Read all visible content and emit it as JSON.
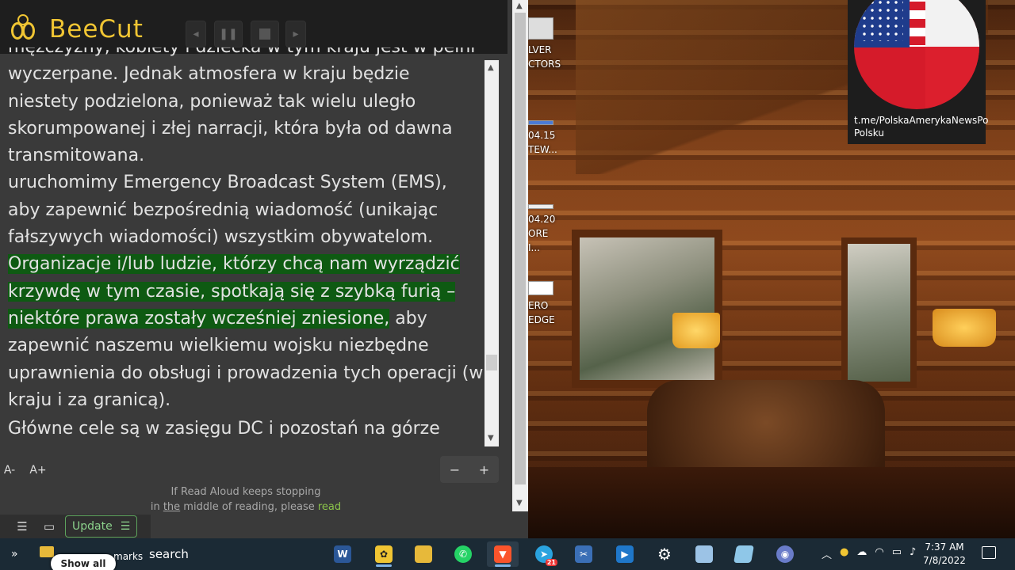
{
  "reader": {
    "brand": "BeeCut",
    "paragraphs": [
      "mężczyzny, kobiety i dziecka w tym kraju jest w pełni wyczerpane. Jednak atmosfera w kraju będzie niestety podzielona, ponieważ tak wielu uległo skorumpowanej i złej narracji, która była od dawna transmitowana.",
      "uruchomimy Emergency Broadcast System (EMS), aby zapewnić bezpośrednią wiadomość (unikając fałszywych wiadomości) wszystkim obywatelom."
    ],
    "highlighted": "Organizacje i/lub ludzie, którzy chcą nam wyrządzić krzywdę w tym czasie, spotkają się z szybką furią – niektóre prawa zostały wcześniej zniesione,",
    "after_highlight": " aby zapewnić naszemu wielkiemu wojsku niezbędne uprawnienia do obsługi i prowadzenia tych operacji (w kraju i za granicą).",
    "last_line": "Główne cele są w zasięgu DC i pozostań na górze",
    "font_decrease": "A-",
    "font_increase": "A+",
    "zoom_minus": "−",
    "zoom_plus": "+",
    "notice_1": "If Read Aloud keeps stopping",
    "notice_2a": "in ",
    "notice_2b": "the",
    "notice_2c": " middle of reading, please ",
    "notice_2d": "read",
    "update_label": "Update"
  },
  "desktop": {
    "icons": [
      {
        "label_1": "LVER",
        "label_2": "CTORS"
      },
      {
        "label_1": "04.15",
        "label_2": "TEW..."
      },
      {
        "label_1": "04.20",
        "label_2": "ORE I..."
      },
      {
        "label_1": "ERO",
        "label_2": "EDGE"
      }
    ],
    "flag_url": "t.me/PolskaAmerykaNewsPo Polsku"
  },
  "taskbar": {
    "show_all": "Show all",
    "marks": "marks",
    "search": "search",
    "time": "7:37 AM",
    "date": "7/8/2022",
    "telegram_badge": "21"
  },
  "colors": {
    "accent": "#f0c533",
    "highlight": "#0e5a12",
    "taskbar": "#1b2a35"
  }
}
